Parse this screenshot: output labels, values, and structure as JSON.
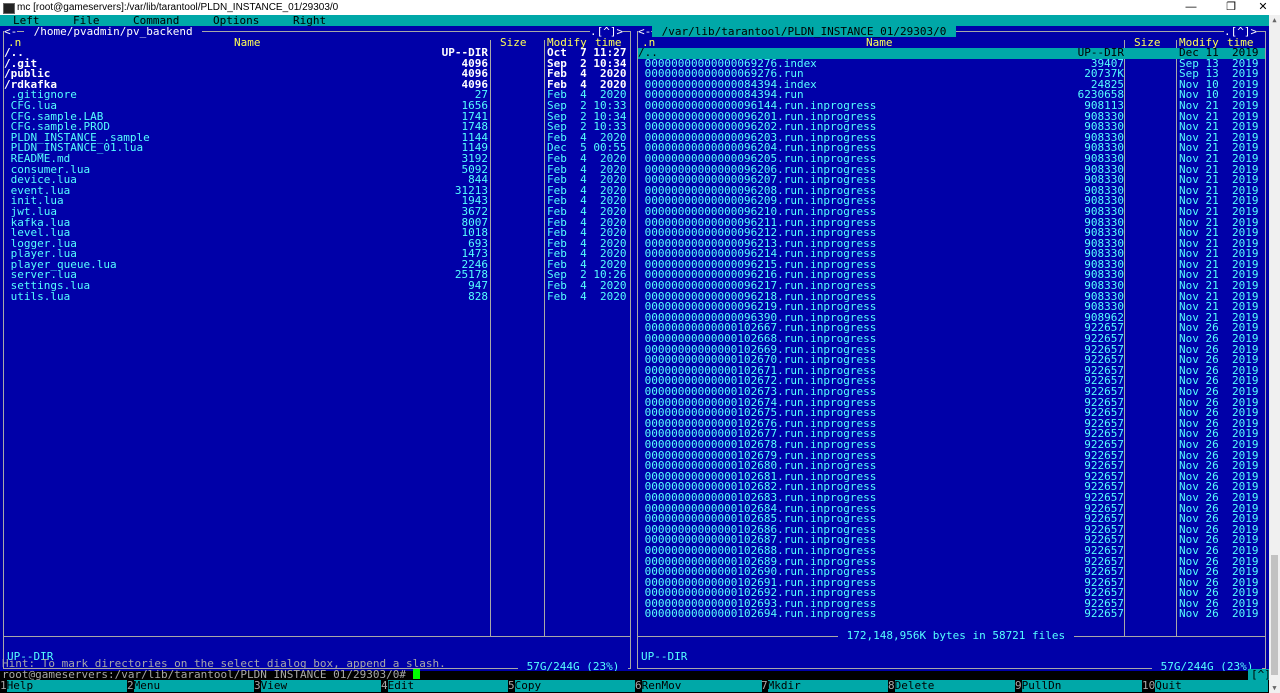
{
  "window": {
    "title": "mc [root@gameservers]:/var/lib/tarantool/PLDN_INSTANCE_01/29303/0",
    "min_label": "—",
    "max_label": "❐",
    "close_label": "✕"
  },
  "menubar": [
    "Left",
    "File",
    "Command",
    "Options",
    "Right"
  ],
  "left_panel": {
    "title": " /home/pvadmin/pv_backend ",
    "corner_left": "<-",
    "corner_right": ".[^]>",
    "headers": {
      "n": ".n",
      "name": "Name",
      "size": "Size",
      "modify": "Modify",
      "time": "time"
    },
    "rows": [
      {
        "name": "/..",
        "size": "UP--DIR",
        "date": "Oct  7 11:27",
        "kind": "dir"
      },
      {
        "name": "/.git",
        "size": "4096",
        "date": "Sep  2 10:34",
        "kind": "dir"
      },
      {
        "name": "/public",
        "size": "4096",
        "date": "Feb  4  2020",
        "kind": "dir"
      },
      {
        "name": "/rdkafka",
        "size": "4096",
        "date": "Feb  4  2020",
        "kind": "dir"
      },
      {
        "name": " .gitignore",
        "size": "27",
        "date": "Feb  4  2020",
        "kind": "file"
      },
      {
        "name": " CFG.lua",
        "size": "1656",
        "date": "Sep  2 10:33",
        "kind": "file"
      },
      {
        "name": " CFG.sample.LAB",
        "size": "1741",
        "date": "Sep  2 10:34",
        "kind": "file"
      },
      {
        "name": " CFG.sample.PROD",
        "size": "1748",
        "date": "Sep  2 10:33",
        "kind": "file"
      },
      {
        "name": " PLDN_INSTANCE_.sample",
        "size": "1144",
        "date": "Feb  4  2020",
        "kind": "file"
      },
      {
        "name": " PLDN_INSTANCE_01.lua",
        "size": "1149",
        "date": "Dec  5 00:55",
        "kind": "file"
      },
      {
        "name": " README.md",
        "size": "3192",
        "date": "Feb  4  2020",
        "kind": "file"
      },
      {
        "name": " consumer.lua",
        "size": "5092",
        "date": "Feb  4  2020",
        "kind": "file"
      },
      {
        "name": " device.lua",
        "size": "844",
        "date": "Feb  4  2020",
        "kind": "file"
      },
      {
        "name": " event.lua",
        "size": "31213",
        "date": "Feb  4  2020",
        "kind": "file"
      },
      {
        "name": " init.lua",
        "size": "1943",
        "date": "Feb  4  2020",
        "kind": "file"
      },
      {
        "name": " jwt.lua",
        "size": "3672",
        "date": "Feb  4  2020",
        "kind": "file"
      },
      {
        "name": " kafka.lua",
        "size": "8007",
        "date": "Feb  4  2020",
        "kind": "file"
      },
      {
        "name": " level.lua",
        "size": "1018",
        "date": "Feb  4  2020",
        "kind": "file"
      },
      {
        "name": " logger.lua",
        "size": "693",
        "date": "Feb  4  2020",
        "kind": "file"
      },
      {
        "name": " player.lua",
        "size": "1473",
        "date": "Feb  4  2020",
        "kind": "file"
      },
      {
        "name": " player_queue.lua",
        "size": "2246",
        "date": "Feb  4  2020",
        "kind": "file"
      },
      {
        "name": " server.lua",
        "size": "25178",
        "date": "Sep  2 10:26",
        "kind": "file"
      },
      {
        "name": " settings.lua",
        "size": "947",
        "date": "Feb  4  2020",
        "kind": "file"
      },
      {
        "name": " utils.lua",
        "size": "828",
        "date": "Feb  4  2020",
        "kind": "file"
      }
    ],
    "status": "UP--DIR",
    "disk": " 57G/244G (23%) "
  },
  "right_panel": {
    "title": " /var/lib/tarantool/PLDN_INSTANCE_01/29303/0 ",
    "corner_left": "<-",
    "corner_right": ".[^]>",
    "headers": {
      "n": ".n",
      "name": "Name",
      "size": "Size",
      "modify": "Modify",
      "time": "time"
    },
    "rows": [
      {
        "name": "/..",
        "size": "UP--DIR",
        "date": "Dec 11  2019",
        "kind": "hl"
      },
      {
        "name": " 00000000000000069276.index",
        "size": "39407",
        "date": "Sep 13  2019",
        "kind": "file"
      },
      {
        "name": " 00000000000000069276.run",
        "size": "20737K",
        "date": "Sep 13  2019",
        "kind": "file"
      },
      {
        "name": " 00000000000000084394.index",
        "size": "24825",
        "date": "Nov 10  2019",
        "kind": "file"
      },
      {
        "name": " 00000000000000084394.run",
        "size": "6230658",
        "date": "Nov 10  2019",
        "kind": "file"
      },
      {
        "name": " 00000000000000096144.run.inprogress",
        "size": "908113",
        "date": "Nov 21  2019",
        "kind": "file"
      },
      {
        "name": " 00000000000000096201.run.inprogress",
        "size": "908330",
        "date": "Nov 21  2019",
        "kind": "file"
      },
      {
        "name": " 00000000000000096202.run.inprogress",
        "size": "908330",
        "date": "Nov 21  2019",
        "kind": "file"
      },
      {
        "name": " 00000000000000096203.run.inprogress",
        "size": "908330",
        "date": "Nov 21  2019",
        "kind": "file"
      },
      {
        "name": " 00000000000000096204.run.inprogress",
        "size": "908330",
        "date": "Nov 21  2019",
        "kind": "file"
      },
      {
        "name": " 00000000000000096205.run.inprogress",
        "size": "908330",
        "date": "Nov 21  2019",
        "kind": "file"
      },
      {
        "name": " 00000000000000096206.run.inprogress",
        "size": "908330",
        "date": "Nov 21  2019",
        "kind": "file"
      },
      {
        "name": " 00000000000000096207.run.inprogress",
        "size": "908330",
        "date": "Nov 21  2019",
        "kind": "file"
      },
      {
        "name": " 00000000000000096208.run.inprogress",
        "size": "908330",
        "date": "Nov 21  2019",
        "kind": "file"
      },
      {
        "name": " 00000000000000096209.run.inprogress",
        "size": "908330",
        "date": "Nov 21  2019",
        "kind": "file"
      },
      {
        "name": " 00000000000000096210.run.inprogress",
        "size": "908330",
        "date": "Nov 21  2019",
        "kind": "file"
      },
      {
        "name": " 00000000000000096211.run.inprogress",
        "size": "908330",
        "date": "Nov 21  2019",
        "kind": "file"
      },
      {
        "name": " 00000000000000096212.run.inprogress",
        "size": "908330",
        "date": "Nov 21  2019",
        "kind": "file"
      },
      {
        "name": " 00000000000000096213.run.inprogress",
        "size": "908330",
        "date": "Nov 21  2019",
        "kind": "file"
      },
      {
        "name": " 00000000000000096214.run.inprogress",
        "size": "908330",
        "date": "Nov 21  2019",
        "kind": "file"
      },
      {
        "name": " 00000000000000096215.run.inprogress",
        "size": "908330",
        "date": "Nov 21  2019",
        "kind": "file"
      },
      {
        "name": " 00000000000000096216.run.inprogress",
        "size": "908330",
        "date": "Nov 21  2019",
        "kind": "file"
      },
      {
        "name": " 00000000000000096217.run.inprogress",
        "size": "908330",
        "date": "Nov 21  2019",
        "kind": "file"
      },
      {
        "name": " 00000000000000096218.run.inprogress",
        "size": "908330",
        "date": "Nov 21  2019",
        "kind": "file"
      },
      {
        "name": " 00000000000000096219.run.inprogress",
        "size": "908330",
        "date": "Nov 21  2019",
        "kind": "file"
      },
      {
        "name": " 00000000000000096390.run.inprogress",
        "size": "908962",
        "date": "Nov 21  2019",
        "kind": "file"
      },
      {
        "name": " 00000000000000102667.run.inprogress",
        "size": "922657",
        "date": "Nov 26  2019",
        "kind": "file"
      },
      {
        "name": " 00000000000000102668.run.inprogress",
        "size": "922657",
        "date": "Nov 26  2019",
        "kind": "file"
      },
      {
        "name": " 00000000000000102669.run.inprogress",
        "size": "922657",
        "date": "Nov 26  2019",
        "kind": "file"
      },
      {
        "name": " 00000000000000102670.run.inprogress",
        "size": "922657",
        "date": "Nov 26  2019",
        "kind": "file"
      },
      {
        "name": " 00000000000000102671.run.inprogress",
        "size": "922657",
        "date": "Nov 26  2019",
        "kind": "file"
      },
      {
        "name": " 00000000000000102672.run.inprogress",
        "size": "922657",
        "date": "Nov 26  2019",
        "kind": "file"
      },
      {
        "name": " 00000000000000102673.run.inprogress",
        "size": "922657",
        "date": "Nov 26  2019",
        "kind": "file"
      },
      {
        "name": " 00000000000000102674.run.inprogress",
        "size": "922657",
        "date": "Nov 26  2019",
        "kind": "file"
      },
      {
        "name": " 00000000000000102675.run.inprogress",
        "size": "922657",
        "date": "Nov 26  2019",
        "kind": "file"
      },
      {
        "name": " 00000000000000102676.run.inprogress",
        "size": "922657",
        "date": "Nov 26  2019",
        "kind": "file"
      },
      {
        "name": " 00000000000000102677.run.inprogress",
        "size": "922657",
        "date": "Nov 26  2019",
        "kind": "file"
      },
      {
        "name": " 00000000000000102678.run.inprogress",
        "size": "922657",
        "date": "Nov 26  2019",
        "kind": "file"
      },
      {
        "name": " 00000000000000102679.run.inprogress",
        "size": "922657",
        "date": "Nov 26  2019",
        "kind": "file"
      },
      {
        "name": " 00000000000000102680.run.inprogress",
        "size": "922657",
        "date": "Nov 26  2019",
        "kind": "file"
      },
      {
        "name": " 00000000000000102681.run.inprogress",
        "size": "922657",
        "date": "Nov 26  2019",
        "kind": "file"
      },
      {
        "name": " 00000000000000102682.run.inprogress",
        "size": "922657",
        "date": "Nov 26  2019",
        "kind": "file"
      },
      {
        "name": " 00000000000000102683.run.inprogress",
        "size": "922657",
        "date": "Nov 26  2019",
        "kind": "file"
      },
      {
        "name": " 00000000000000102684.run.inprogress",
        "size": "922657",
        "date": "Nov 26  2019",
        "kind": "file"
      },
      {
        "name": " 00000000000000102685.run.inprogress",
        "size": "922657",
        "date": "Nov 26  2019",
        "kind": "file"
      },
      {
        "name": " 00000000000000102686.run.inprogress",
        "size": "922657",
        "date": "Nov 26  2019",
        "kind": "file"
      },
      {
        "name": " 00000000000000102687.run.inprogress",
        "size": "922657",
        "date": "Nov 26  2019",
        "kind": "file"
      },
      {
        "name": " 00000000000000102688.run.inprogress",
        "size": "922657",
        "date": "Nov 26  2019",
        "kind": "file"
      },
      {
        "name": " 00000000000000102689.run.inprogress",
        "size": "922657",
        "date": "Nov 26  2019",
        "kind": "file"
      },
      {
        "name": " 00000000000000102690.run.inprogress",
        "size": "922657",
        "date": "Nov 26  2019",
        "kind": "file"
      },
      {
        "name": " 00000000000000102691.run.inprogress",
        "size": "922657",
        "date": "Nov 26  2019",
        "kind": "file"
      },
      {
        "name": " 00000000000000102692.run.inprogress",
        "size": "922657",
        "date": "Nov 26  2019",
        "kind": "file"
      },
      {
        "name": " 00000000000000102693.run.inprogress",
        "size": "922657",
        "date": "Nov 26  2019",
        "kind": "file"
      },
      {
        "name": " 00000000000000102694.run.inprogress",
        "size": "922657",
        "date": "Nov 26  2019",
        "kind": "file"
      }
    ],
    "summary": " 172,148,956K bytes in 58721 files ",
    "status": "UP--DIR",
    "disk": " 57G/244G (23%) "
  },
  "hint": "Hint: To mark directories on the select dialog box, append a slash.",
  "prompt": "root@gameservers:/var/lib/tarantool/PLDN_INSTANCE_01/29303/0# ",
  "prompt_badge": "[^]",
  "fkeys": [
    {
      "num": "1",
      "label": "Help"
    },
    {
      "num": "2",
      "label": "Menu"
    },
    {
      "num": "3",
      "label": "View"
    },
    {
      "num": "4",
      "label": "Edit"
    },
    {
      "num": "5",
      "label": "Copy"
    },
    {
      "num": "6",
      "label": "RenMov"
    },
    {
      "num": "7",
      "label": "Mkdir"
    },
    {
      "num": "8",
      "label": "Delete"
    },
    {
      "num": "9",
      "label": "PullDn"
    },
    {
      "num": "10",
      "label": "Quit"
    }
  ],
  "colors": {
    "panel_bg": "#0000a8",
    "panel_fg": "#55ffff",
    "accent": "#00a8a8",
    "header_fg": "#ffff55"
  }
}
